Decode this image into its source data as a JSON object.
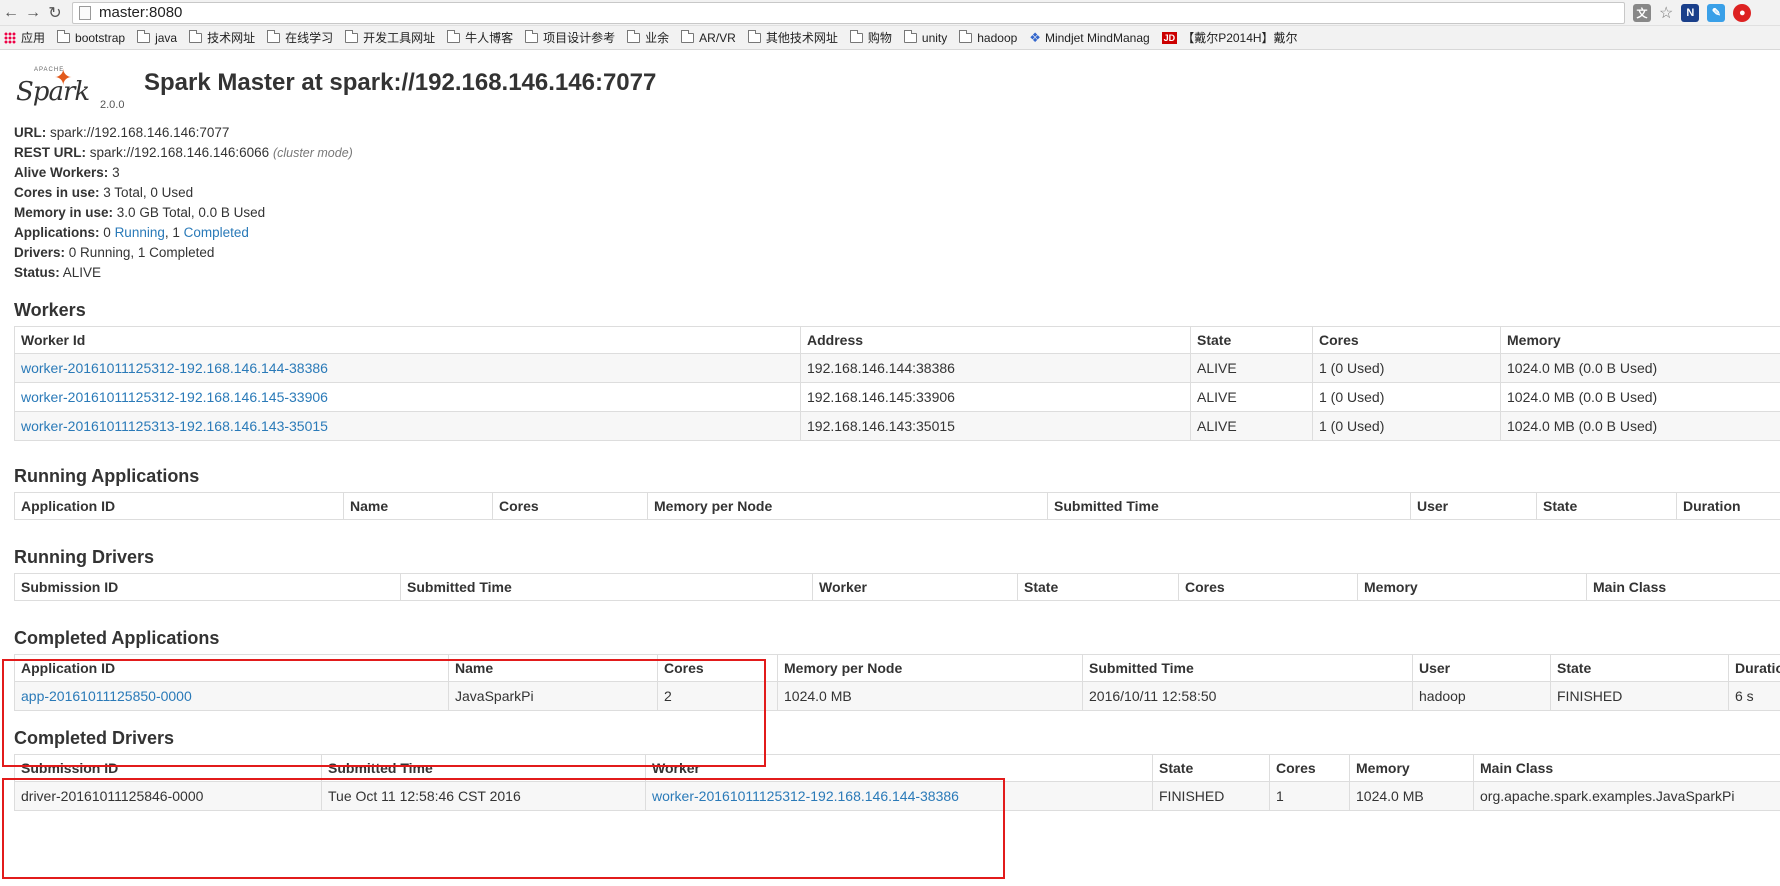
{
  "browser": {
    "url": "master:8080",
    "bookmarks": [
      "应用",
      "bootstrap",
      "java",
      "技术网址",
      "在线学习",
      "开发工具网址",
      "牛人博客",
      "项目设计参考",
      "业余",
      "AR/VR",
      "其他技术网址",
      "购物",
      "unity",
      "hadoop",
      "Mindjet MindManag",
      "【戴尔P2014H】戴尔"
    ]
  },
  "header": {
    "logo_apache": "APACHE",
    "logo_word": "Spark",
    "version": "2.0.0",
    "title": "Spark Master at spark://192.168.146.146:7077"
  },
  "summary": {
    "url_label": "URL:",
    "url_value": "spark://192.168.146.146:7077",
    "rest_label": "REST URL:",
    "rest_value": "spark://192.168.146.146:6066",
    "rest_mode": "(cluster mode)",
    "workers_label": "Alive Workers:",
    "workers_value": "3",
    "cores_label": "Cores in use:",
    "cores_value": "3 Total, 0 Used",
    "memory_label": "Memory in use:",
    "memory_value": "3.0 GB Total, 0.0 B Used",
    "apps_label": "Applications:",
    "apps_prefix": "0",
    "apps_running": "Running",
    "apps_sep": ", 1",
    "apps_completed": "Completed",
    "drivers_label": "Drivers:",
    "drivers_value": "0 Running, 1 Completed",
    "status_label": "Status:",
    "status_value": "ALIVE"
  },
  "workers": {
    "title": "Workers",
    "headers": [
      "Worker Id",
      "Address",
      "State",
      "Cores",
      "Memory"
    ],
    "rows": [
      [
        "worker-20161011125312-192.168.146.144-38386",
        "192.168.146.144:38386",
        "ALIVE",
        "1 (0 Used)",
        "1024.0 MB (0.0 B Used)"
      ],
      [
        "worker-20161011125312-192.168.146.145-33906",
        "192.168.146.145:33906",
        "ALIVE",
        "1 (0 Used)",
        "1024.0 MB (0.0 B Used)"
      ],
      [
        "worker-20161011125313-192.168.146.143-35015",
        "192.168.146.143:35015",
        "ALIVE",
        "1 (0 Used)",
        "1024.0 MB (0.0 B Used)"
      ]
    ]
  },
  "running_apps": {
    "title": "Running Applications",
    "headers": [
      "Application ID",
      "Name",
      "Cores",
      "Memory per Node",
      "Submitted Time",
      "User",
      "State",
      "Duration"
    ]
  },
  "running_drivers": {
    "title": "Running Drivers",
    "headers": [
      "Submission ID",
      "Submitted Time",
      "Worker",
      "State",
      "Cores",
      "Memory",
      "Main Class"
    ]
  },
  "completed_apps": {
    "title": "Completed Applications",
    "headers": [
      "Application ID",
      "Name",
      "Cores",
      "Memory per Node",
      "Submitted Time",
      "User",
      "State",
      "Duratio"
    ],
    "rows": [
      [
        "app-20161011125850-0000",
        "JavaSparkPi",
        "2",
        "1024.0 MB",
        "2016/10/11 12:58:50",
        "hadoop",
        "FINISHED",
        "6 s"
      ]
    ]
  },
  "completed_drivers": {
    "title": "Completed Drivers",
    "headers": [
      "Submission ID",
      "Submitted Time",
      "Worker",
      "State",
      "Cores",
      "Memory",
      "Main Class"
    ],
    "rows": [
      [
        "driver-20161011125846-0000",
        "Tue Oct 11 12:58:46 CST 2016",
        "worker-20161011125312-192.168.146.144-38386",
        "FINISHED",
        "1",
        "1024.0 MB",
        "org.apache.spark.examples.JavaSparkPi"
      ]
    ]
  },
  "colors": {
    "link": "#2a7ab8",
    "highlight": "#e21b1b",
    "logo_star": "#e25a1c"
  }
}
